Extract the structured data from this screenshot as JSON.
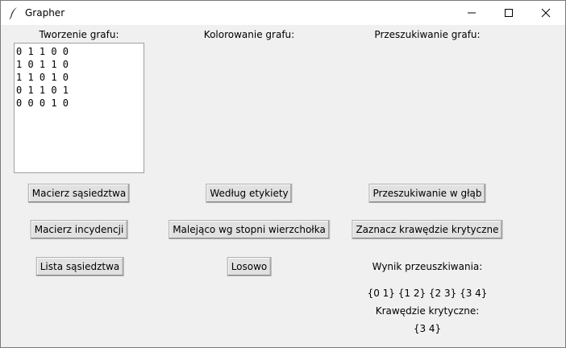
{
  "window": {
    "title": "Grapher"
  },
  "sections": {
    "create": {
      "title": "Tworzenie grafu:",
      "textbox_value": "0 1 1 0 0\n1 0 1 1 0\n1 1 0 1 0\n0 1 1 0 1\n0 0 0 1 0",
      "buttons": [
        "Macierz sąsiedztwa",
        "Macierz incydencji",
        "Lista sąsiedztwa"
      ]
    },
    "coloring": {
      "title": "Kolorowanie grafu:",
      "buttons": [
        "Według etykiety",
        "Malejąco wg stopni wierzchołka",
        "Losowo"
      ]
    },
    "search": {
      "title": "Przeszukiwanie grafu:",
      "buttons": [
        "Przeszukiwanie w głąb",
        "Zaznacz krawędzie krytyczne"
      ],
      "result_label": "Wynik przeuszkiwania:",
      "result_value": "{0 1} {1 2} {2 3} {3 4}",
      "critical_label": "Krawędzie krytyczne:",
      "critical_value": "{3 4}"
    }
  }
}
